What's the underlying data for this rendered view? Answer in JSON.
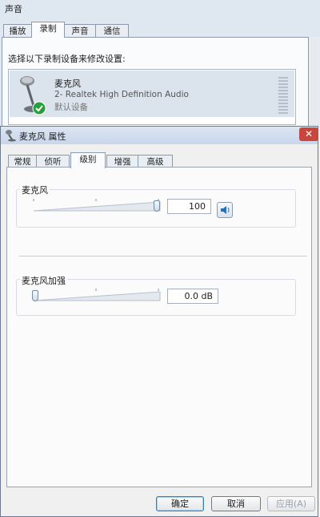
{
  "back_window": {
    "title": "声音",
    "tabs": [
      "播放",
      "录制",
      "声音",
      "通信"
    ],
    "selected_tab": 1,
    "prompt": "选择以下录制设备来修改设置:",
    "device": {
      "name": "麦克风",
      "description": "2- Realtek High Definition Audio",
      "status": "默认设备"
    }
  },
  "dialog": {
    "title": "麦克风 属性",
    "close_symbol": "✕",
    "tabs": [
      "常规",
      "侦听",
      "级别",
      "增强",
      "高级"
    ],
    "selected_tab": 2,
    "microphone": {
      "label": "麦克风",
      "value": "100",
      "level": 1.0
    },
    "boost": {
      "label": "麦克风加强",
      "value": "0.0 dB",
      "level": 0.0
    },
    "buttons": {
      "ok": "确定",
      "cancel": "取消",
      "apply": "应用(A)"
    }
  },
  "colors": {
    "accent": "#3c7fb1",
    "status_green": "#2a9d3c"
  },
  "icons": [
    "microphone-icon",
    "check-icon",
    "speaker-icon",
    "dialog-icon"
  ]
}
